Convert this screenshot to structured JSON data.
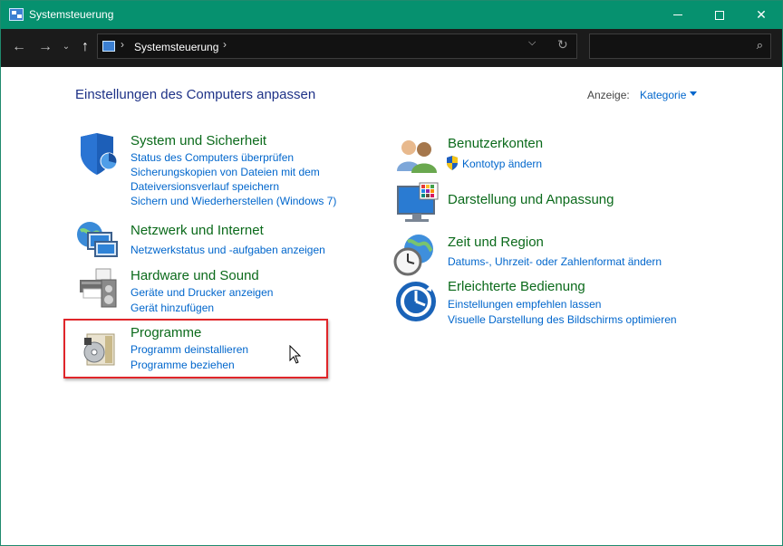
{
  "window": {
    "title": "Systemsteuerung"
  },
  "address_bar": {
    "crumb": "Systemsteuerung",
    "search_placeholder": ""
  },
  "content": {
    "heading": "Einstellungen des Computers anpassen",
    "view_label": "Anzeige:",
    "view_value": "Kategorie"
  },
  "left_categories": [
    {
      "title": "System und Sicherheit",
      "links": [
        "Status des Computers überprüfen",
        "Sicherungskopien von Dateien mit dem",
        "Dateiversionsverlauf speichern",
        "Sichern und Wiederherstellen (Windows 7)"
      ]
    },
    {
      "title": "Netzwerk und Internet",
      "links": [
        "Netzwerkstatus und -aufgaben anzeigen"
      ]
    },
    {
      "title": "Hardware und Sound",
      "links": [
        "Geräte und Drucker anzeigen",
        "Gerät hinzufügen"
      ]
    },
    {
      "title": "Programme",
      "links": [
        "Programm deinstallieren",
        "Programme beziehen"
      ]
    }
  ],
  "right_categories": [
    {
      "title": "Benutzerkonten",
      "links": [
        "Kontotyp ändern"
      ]
    },
    {
      "title": "Darstellung und Anpassung",
      "links": []
    },
    {
      "title": "Zeit und Region",
      "links": [
        "Datums-, Uhrzeit- oder Zahlenformat ändern"
      ]
    },
    {
      "title": "Erleichterte Bedienung",
      "links": [
        "Einstellungen empfehlen lassen",
        "Visuelle Darstellung des Bildschirms optimieren"
      ]
    }
  ],
  "colors": {
    "titlebar": "#06916f",
    "category_title": "#0b6a1b",
    "link": "#0066cc",
    "highlight": "#e0262a"
  }
}
